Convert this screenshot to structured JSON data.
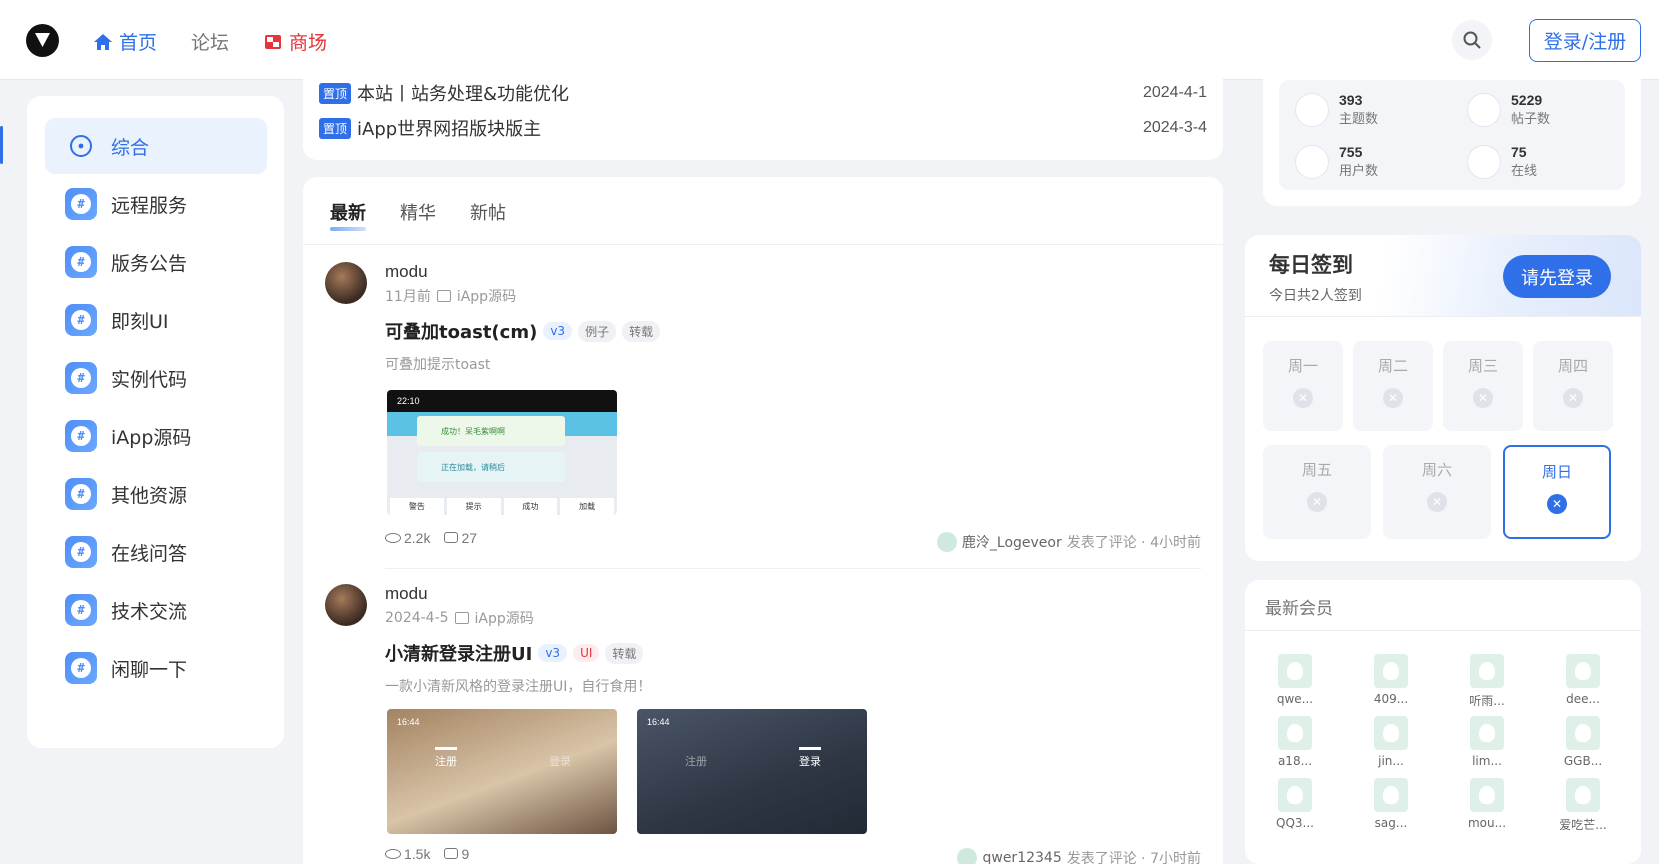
{
  "header": {
    "nav": [
      {
        "label": "首页",
        "icon": "home-icon",
        "active": true
      },
      {
        "label": "论坛",
        "icon": null,
        "active": false
      },
      {
        "label": "商场",
        "icon": "shop-icon",
        "active": false
      }
    ],
    "login_label": "登录/注册"
  },
  "sidebar": {
    "items": [
      {
        "label": "综合",
        "icon": "compass-icon",
        "active": true
      },
      {
        "label": "远程服务",
        "icon": "hash-icon"
      },
      {
        "label": "版务公告",
        "icon": "hash-icon"
      },
      {
        "label": "即刻UI",
        "icon": "hash-icon"
      },
      {
        "label": "实例代码",
        "icon": "hash-icon"
      },
      {
        "label": "iApp源码",
        "icon": "hash-icon"
      },
      {
        "label": "其他资源",
        "icon": "hash-icon"
      },
      {
        "label": "在线问答",
        "icon": "hash-icon"
      },
      {
        "label": "技术交流",
        "icon": "hash-icon"
      },
      {
        "label": "闲聊一下",
        "icon": "hash-icon"
      }
    ]
  },
  "pinned": [
    {
      "badge": "置顶",
      "title": "本站丨站务处理&功能优化",
      "date": "2024-4-1"
    },
    {
      "badge": "置顶",
      "title": "iApp世界网招版块版主",
      "date": "2024-3-4"
    }
  ],
  "feed": {
    "tabs": [
      "最新",
      "精华",
      "新帖"
    ],
    "posts": [
      {
        "author": "modu",
        "time": "11月前",
        "category": "iApp源码",
        "title": "可叠加toast(cm)",
        "tags": [
          "v3",
          "例子",
          "转载"
        ],
        "excerpt": "可叠加提示toast",
        "views": "2.2k",
        "comments": "27",
        "reply_user": "鹿泠_Logeveor",
        "reply_text": "发表了评论 · 4小时前",
        "thumb_texts": [
          "22:10",
          "成功！呆毛紫啊啊",
          "正在加载，请稍后",
          "警告",
          "提示",
          "成功",
          "加载"
        ]
      },
      {
        "author": "modu",
        "time": "2024-4-5",
        "category": "iApp源码",
        "title": "小清新登录注册UI",
        "tags": [
          "v3",
          "UI",
          "转载"
        ],
        "excerpt": "一款小清新风格的登录注册UI，自行食用！",
        "views": "1.5k",
        "comments": "9",
        "reply_user": "qwer12345",
        "reply_text": "发表了评论 · 7小时前",
        "thumb_texts": [
          "16:44",
          "注册",
          "登录"
        ]
      }
    ]
  },
  "site_stats": [
    {
      "value": "393",
      "label": "主题数",
      "icon": "document-icon"
    },
    {
      "value": "5229",
      "label": "帖子数",
      "icon": "message-icon"
    },
    {
      "value": "755",
      "label": "用户数",
      "icon": "users-icon"
    },
    {
      "value": "75",
      "label": "在线",
      "icon": "broadcast-icon"
    }
  ],
  "checkin": {
    "title": "每日签到",
    "subtitle": "今日共2人签到",
    "button": "请先登录",
    "days": [
      "周一",
      "周二",
      "周三",
      "周四",
      "周五",
      "周六",
      "周日"
    ],
    "today": "周日"
  },
  "members": {
    "title": "最新会员",
    "list": [
      "qwe...",
      "409...",
      "听雨...",
      "dee...",
      "a18...",
      "jin...",
      "lim...",
      "GGB...",
      "QQ3...",
      "sag...",
      "mou...",
      "爱吃芒..."
    ]
  },
  "colors": {
    "accent": "#2f6fe8",
    "shop": "#e5343a",
    "background": "#f1f3f7"
  }
}
